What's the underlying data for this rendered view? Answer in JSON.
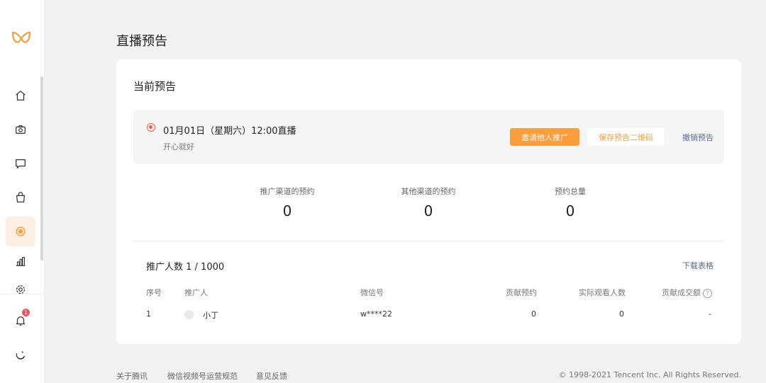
{
  "page": {
    "title": "直播预告"
  },
  "card": {
    "section_title": "当前预告",
    "preview": {
      "time": "01月01日（星期六）12:00直播",
      "description": "开心就好",
      "invite_button": "邀请他人推广",
      "save_qr_button": "保存预告二维码",
      "cancel_link": "撤销预告"
    },
    "stats": [
      {
        "label": "推广渠道的预约",
        "value": "0"
      },
      {
        "label": "其他渠道的预约",
        "value": "0"
      },
      {
        "label": "预约总量",
        "value": "0"
      }
    ],
    "promoters_count": "推广人数 1 / 1000",
    "download_link": "下载表格",
    "table": {
      "columns": [
        "序号",
        "推广人",
        "微信号",
        "贡献预约",
        "实际观看人数",
        "贡献成交额"
      ],
      "help_icon": "question-circle-icon",
      "rows": [
        {
          "index": "1",
          "promoter": "小丁",
          "wechat": "w****22",
          "reservations": "0",
          "viewers": "0",
          "sales": "-"
        }
      ]
    }
  },
  "sidebar": {
    "logo": "channels-logo-icon",
    "items": [
      {
        "icon": "home-icon"
      },
      {
        "icon": "camera-icon"
      },
      {
        "icon": "comment-icon"
      },
      {
        "icon": "shopping-bag-icon"
      },
      {
        "icon": "live-icon",
        "active": true
      },
      {
        "icon": "bar-chart-icon"
      },
      {
        "icon": "settings-icon"
      }
    ],
    "notification_badge": "1",
    "bottom_icon": "user-profile-icon"
  },
  "footer": {
    "links": [
      "关于腾讯",
      "微信视频号运营规范",
      "意见反馈"
    ],
    "copyright": "© 1998-2021 Tencent Inc. All Rights Reserved."
  },
  "colors": {
    "accent": "#fa9d3b",
    "link": "#576b95",
    "live_red": "#f15a3c"
  }
}
